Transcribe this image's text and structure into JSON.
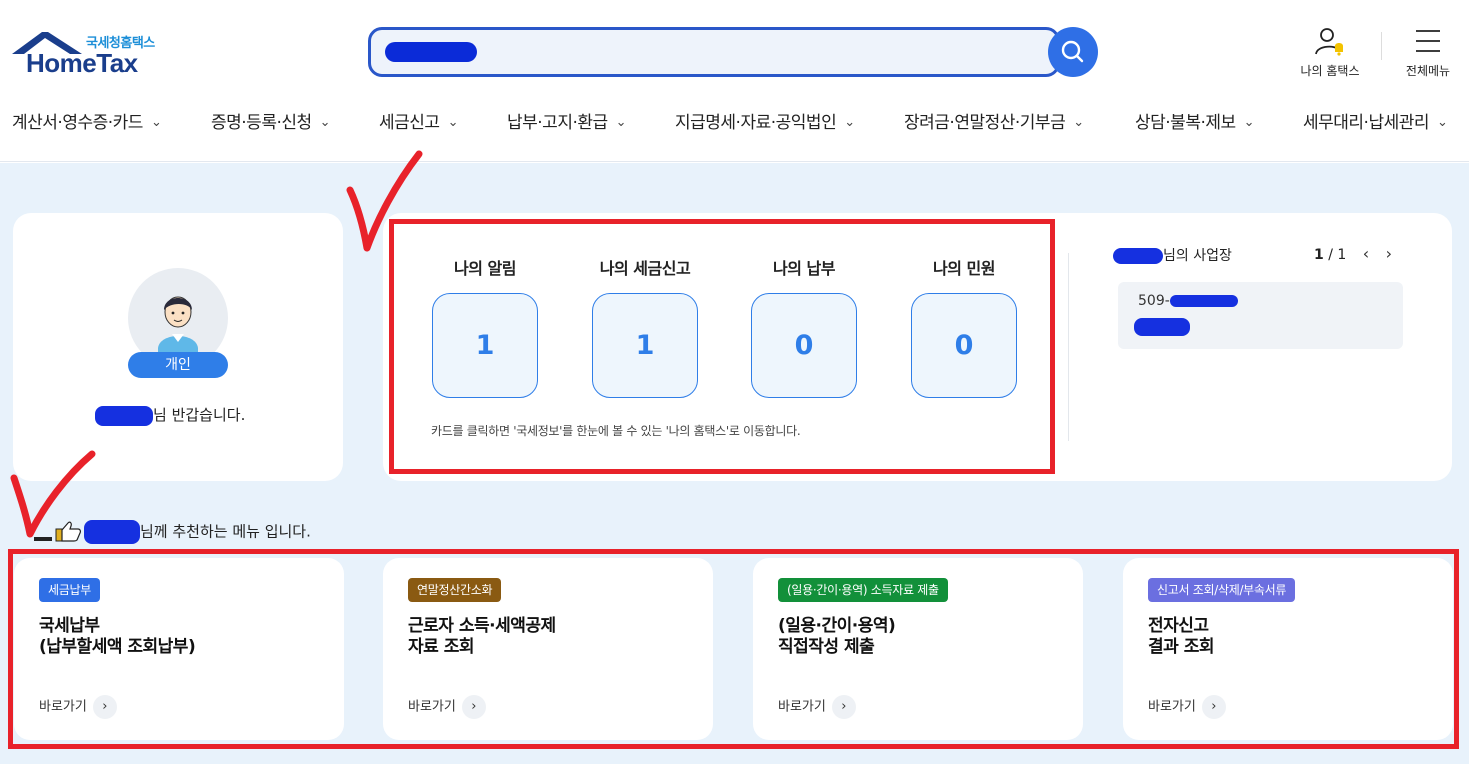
{
  "header": {
    "logo_small": "국세청홈택스",
    "logo_main": "HomeTax",
    "search": {
      "value": "",
      "placeholder": ""
    },
    "utilities": {
      "my_hometax": "나의 홈택스",
      "all_menu": "전체메뉴"
    },
    "nav": [
      "계산서·영수증·카드",
      "증명·등록·신청",
      "세금신고",
      "납부·고지·환급",
      "지급명세·자료·공익법인",
      "장려금·연말정산·기부금",
      "상담·불복·제보",
      "세무대리·납세관리"
    ]
  },
  "profile": {
    "badge": "개인",
    "greeting_suffix": "님 반갑습니다."
  },
  "stats": [
    {
      "title": "나의 알림",
      "value": "1"
    },
    {
      "title": "나의 세금신고",
      "value": "1"
    },
    {
      "title": "나의 납부",
      "value": "0"
    },
    {
      "title": "나의 민원",
      "value": "0"
    }
  ],
  "stats_note": "카드를 클릭하면 '국세정보'를 한눈에 볼 수 있는 '나의 홈택스'로 이동합니다.",
  "business": {
    "title_suffix": "님의 사업장",
    "page_current": "1",
    "page_total": "/ 1",
    "number_prefix": "509-"
  },
  "recommend": {
    "title_suffix": "님께 추천하는 메뉴 입니다.",
    "cards": [
      {
        "tag": "세금납부",
        "tag_color": "#2f6fe6",
        "name_line1": "국세납부",
        "name_line2": "(납부할세액 조회납부)",
        "go": "바로가기"
      },
      {
        "tag": "연말정산간소화",
        "tag_color": "#8a5a12",
        "name_line1": "근로자 소득·세액공제",
        "name_line2": "자료 조회",
        "go": "바로가기"
      },
      {
        "tag": "(일용·간이·용역) 소득자료 제출",
        "tag_color": "#12903a",
        "name_line1": "(일용·간이·용역)",
        "name_line2": "직접작성 제출",
        "go": "바로가기"
      },
      {
        "tag": "신고서 조회/삭제/부속서류",
        "tag_color": "#6b6fe0",
        "name_line1": "전자신고",
        "name_line2": "결과 조회",
        "go": "바로가기"
      }
    ]
  },
  "colors": {
    "primary": "#2f7ee8",
    "highlight": "#e8222a",
    "background": "#e8f2fb"
  }
}
